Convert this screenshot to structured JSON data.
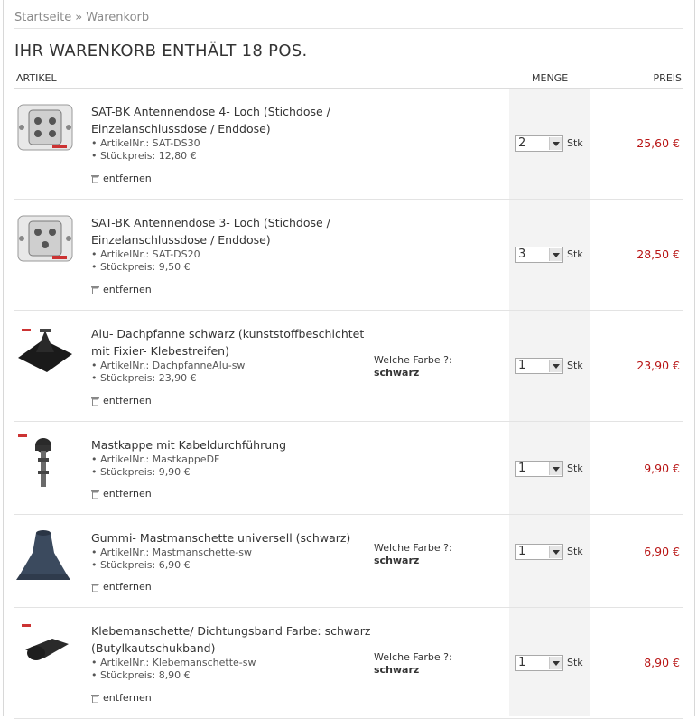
{
  "breadcrumb": {
    "home": "Startseite",
    "separator": "»",
    "current": "Warenkorb"
  },
  "cart": {
    "title": "IHR WARENKORB ENTHÄLT 18 POS."
  },
  "columns": {
    "artikel": "ARTIKEL",
    "menge": "MENGE",
    "preis": "PREIS"
  },
  "labels": {
    "remove": "entfernen",
    "unit": "Stk"
  },
  "colors": {
    "price": "#b81414",
    "menge_bg": "#f3f3f3"
  },
  "items": [
    {
      "name": "SAT-BK Antennendose 4- Loch (Stichdose / Einzelanschlussdose / Enddose)",
      "sku": "• ArtikelNr.: SAT-DS30",
      "unit_price": "• Stückpreis: 12,80 €",
      "variant_label": "",
      "variant_value": "",
      "qty": "2",
      "price": "25,60 €",
      "image": "antenna-socket-4-hole"
    },
    {
      "name": "SAT-BK Antennendose 3- Loch (Stichdose / Einzelanschlussdose / Enddose)",
      "sku": "• ArtikelNr.: SAT-DS20",
      "unit_price": "• Stückpreis: 9,50 €",
      "variant_label": "",
      "variant_value": "",
      "qty": "3",
      "price": "28,50 €",
      "image": "antenna-socket-3-hole"
    },
    {
      "name": "Alu- Dachpfanne schwarz (kunststoffbeschichtet mit Fixier- Klebestreifen)",
      "sku": "• ArtikelNr.: DachpfanneAlu-sw",
      "unit_price": "• Stückpreis: 23,90 €",
      "variant_label": "Welche Farbe ?:",
      "variant_value": "schwarz",
      "qty": "1",
      "price": "23,90 €",
      "image": "roof-tile"
    },
    {
      "name": "Mastkappe mit Kabeldurchführung",
      "sku": "• ArtikelNr.: MastkappeDF",
      "unit_price": "• Stückpreis: 9,90 €",
      "variant_label": "",
      "variant_value": "",
      "qty": "1",
      "price": "9,90 €",
      "image": "mast-cap"
    },
    {
      "name": "Gummi- Mastmanschette universell (schwarz)",
      "sku": "• ArtikelNr.: Mastmanschette-sw",
      "unit_price": "• Stückpreis: 6,90 €",
      "variant_label": "Welche Farbe ?:",
      "variant_value": "schwarz",
      "qty": "1",
      "price": "6,90 €",
      "image": "rubber-mast-collar"
    },
    {
      "name": "Klebemanschette/ Dichtungsband Farbe: schwarz (Butylkautschukband)",
      "sku": "• ArtikelNr.: Klebemanschette-sw",
      "unit_price": "• Stückpreis: 8,90 €",
      "variant_label": "Welche Farbe ?:",
      "variant_value": "schwarz",
      "qty": "1",
      "price": "8,90 €",
      "image": "adhesive-collar"
    }
  ]
}
